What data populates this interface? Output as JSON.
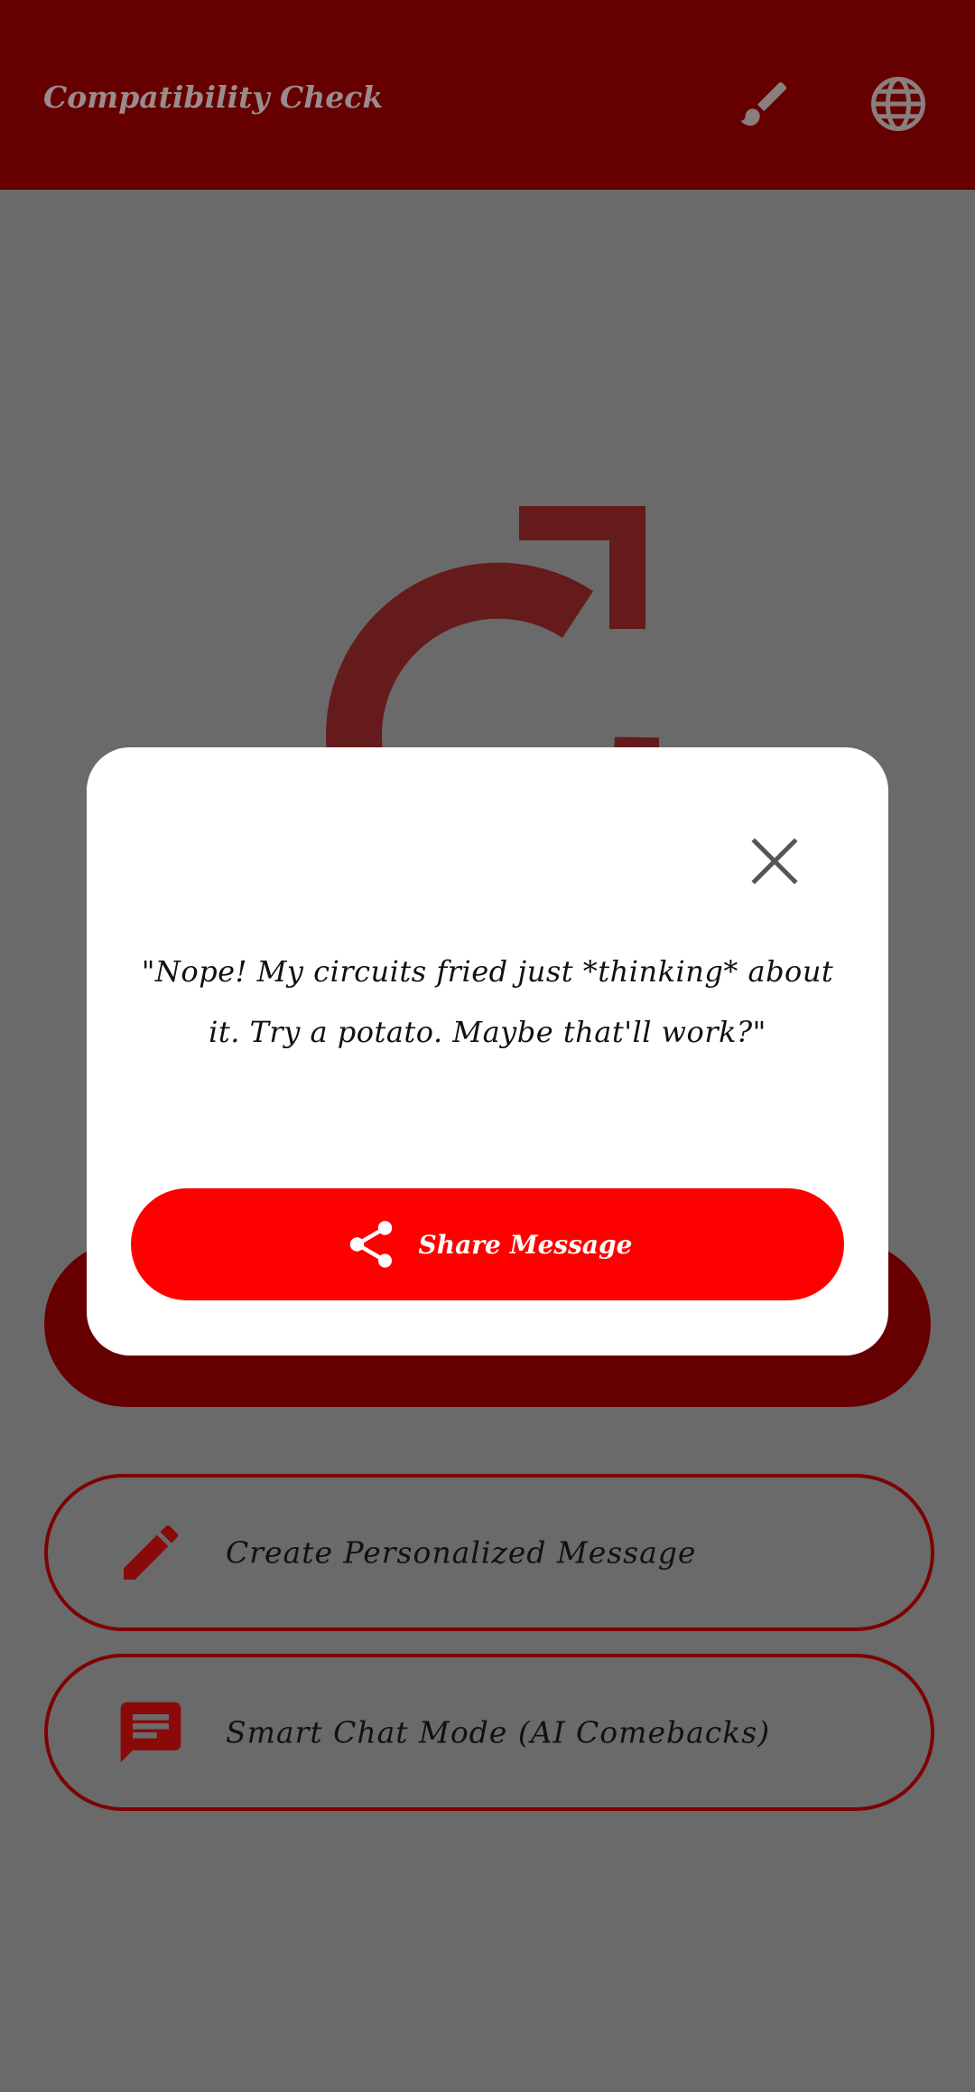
{
  "app_bar": {
    "title": "Compatibility Check",
    "brush_icon": "brush-icon",
    "globe_icon": "globe-icon"
  },
  "background": {
    "refresh_icon": "refresh-icon"
  },
  "options": [
    {
      "label": "Create Personalized Message",
      "icon": "pencil-icon"
    },
    {
      "label": "Smart Chat Mode (AI Comebacks)",
      "icon": "chat-icon"
    }
  ],
  "dialog": {
    "close_icon": "close-icon",
    "message": "\"Nope! My circuits fried just *thinking* about it. Try a potato. Maybe that'll work?\"",
    "share_label": "Share Message",
    "share_icon": "share-icon"
  },
  "colors": {
    "app_bar": "#660000",
    "scrim": "#6a6a6a",
    "accent": "#ff0000",
    "outline": "#7e0202"
  }
}
